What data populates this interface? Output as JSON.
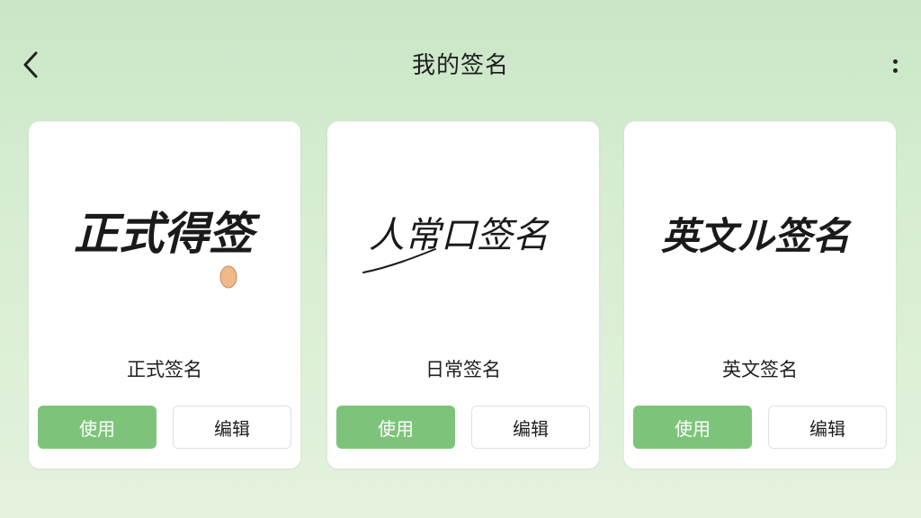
{
  "header": {
    "title": "我的签名"
  },
  "colors": {
    "accent": "#7dc47a",
    "background": "#d7edd2"
  },
  "cards": [
    {
      "signature_text": "正式得签",
      "label": "正式签名",
      "use_label": "使用",
      "edit_label": "编辑"
    },
    {
      "signature_text": "人常口签名",
      "label": "日常签名",
      "use_label": "使用",
      "edit_label": "编辑"
    },
    {
      "signature_text": "英文ル签名",
      "label": "英文签名",
      "use_label": "使用",
      "edit_label": "编辑"
    }
  ]
}
